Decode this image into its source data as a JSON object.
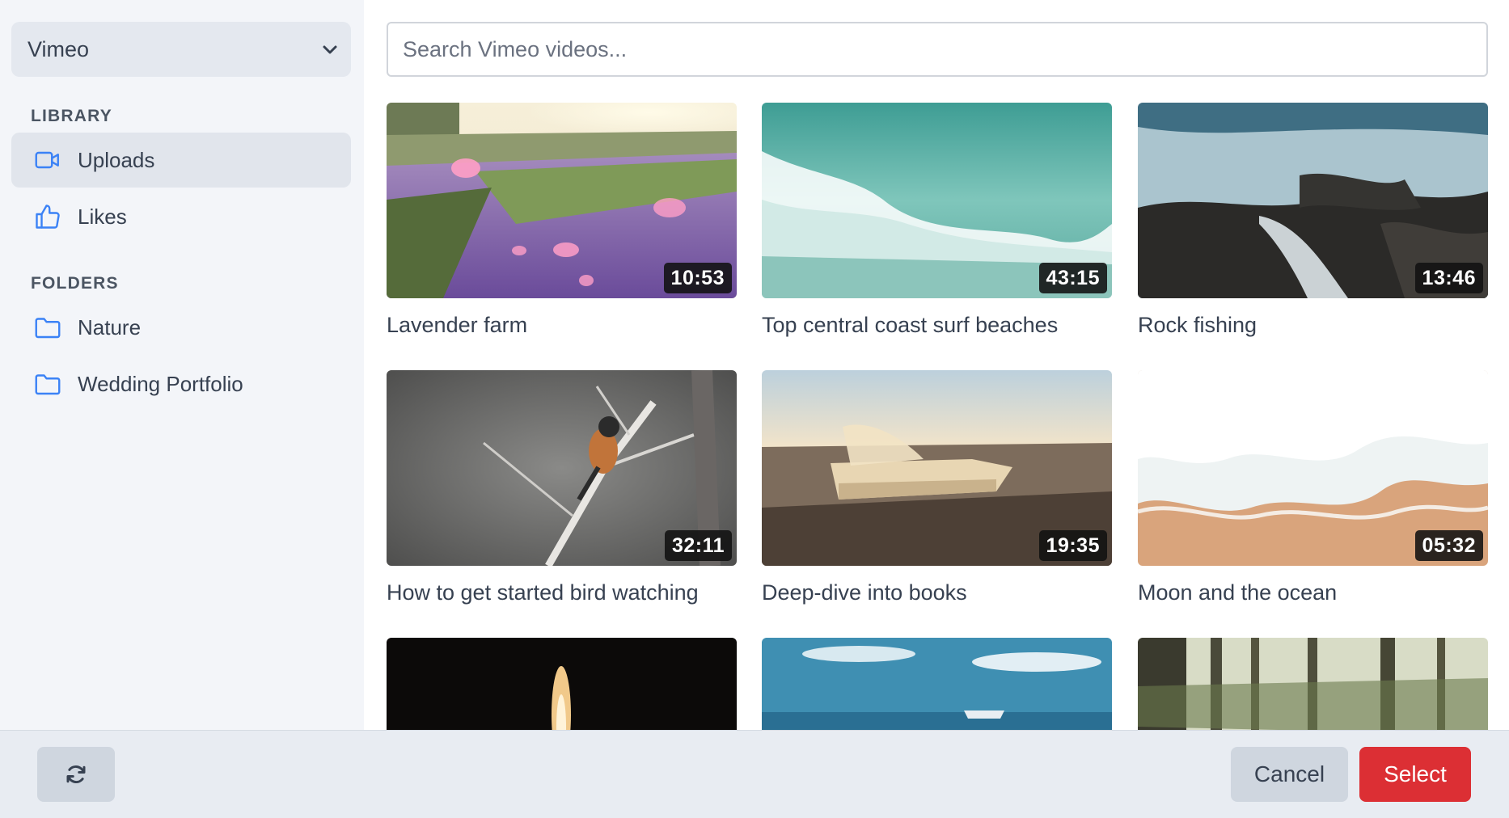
{
  "source": {
    "selected": "Vimeo"
  },
  "search": {
    "placeholder": "Search Vimeo videos..."
  },
  "sidebar": {
    "library_heading": "LIBRARY",
    "library_items": [
      {
        "label": "Uploads",
        "icon": "video-camera-icon",
        "active": true
      },
      {
        "label": "Likes",
        "icon": "thumbs-up-icon",
        "active": false
      }
    ],
    "folders_heading": "FOLDERS",
    "folder_items": [
      {
        "label": "Nature",
        "icon": "folder-icon"
      },
      {
        "label": "Wedding Portfolio",
        "icon": "folder-icon"
      }
    ]
  },
  "videos": [
    {
      "title": "Lavender farm",
      "duration": "10:53"
    },
    {
      "title": "Top central coast surf beaches",
      "duration": "43:15"
    },
    {
      "title": "Rock fishing",
      "duration": "13:46"
    },
    {
      "title": "How to get started bird watching",
      "duration": "32:11"
    },
    {
      "title": "Deep-dive into books",
      "duration": "19:35"
    },
    {
      "title": "Moon and the ocean",
      "duration": "05:32"
    },
    {
      "title": "",
      "duration": ""
    },
    {
      "title": "",
      "duration": ""
    },
    {
      "title": "",
      "duration": ""
    }
  ],
  "footer": {
    "cancel_label": "Cancel",
    "select_label": "Select"
  },
  "colors": {
    "accent": "#dc2f34",
    "icon_blue": "#3b82f6",
    "sidebar_bg": "#f3f5f9"
  }
}
